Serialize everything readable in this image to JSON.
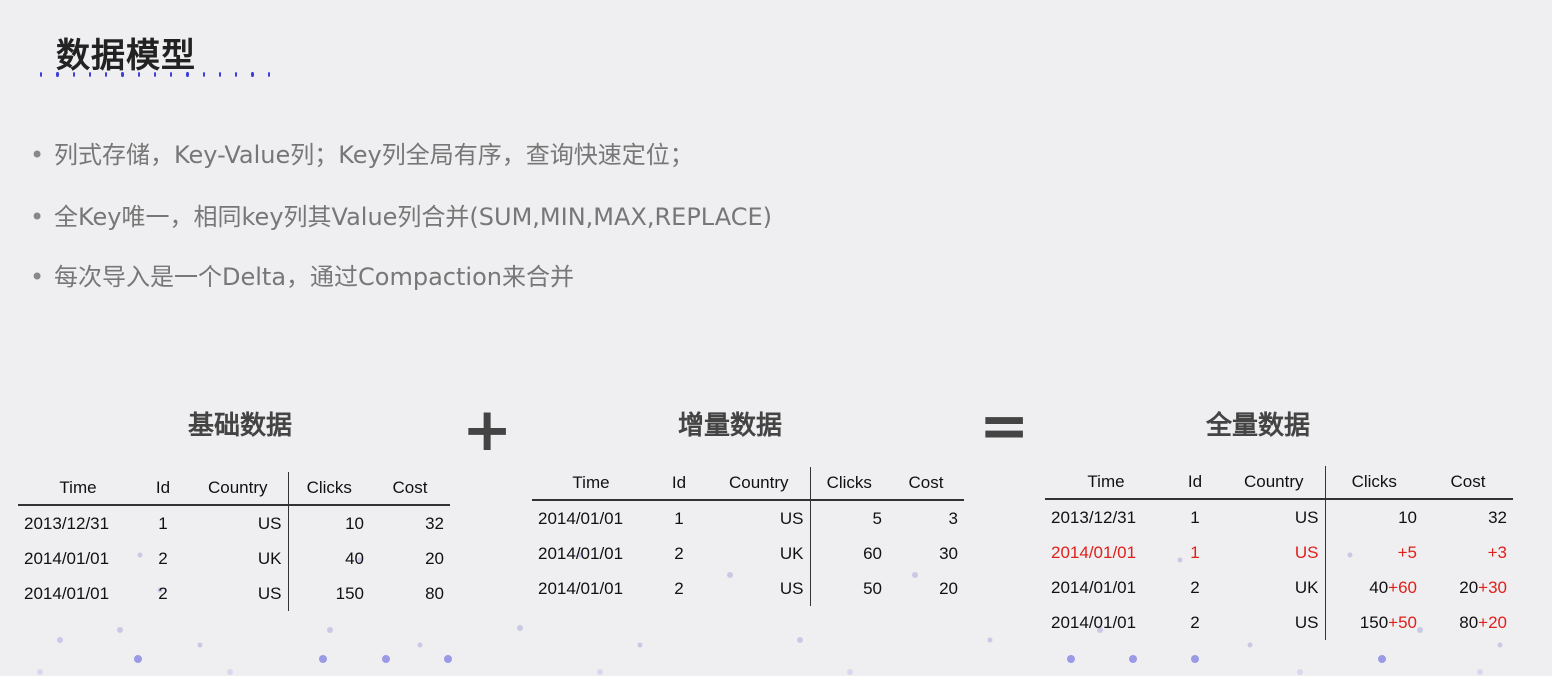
{
  "title": "数据模型",
  "bullets": [
    "列式存储，Key-Value列；Key列全局有序，查询快速定位；",
    "全Key唯一，相同key列其Value列合并(SUM,MIN,MAX,REPLACE)",
    "每次导入是一个Delta，通过Compaction来合并"
  ],
  "bullet_symbol": "•",
  "operators": {
    "plus": "+",
    "equals": "="
  },
  "base": {
    "title": "基础数据",
    "headers": [
      "Time",
      "Id",
      "Country",
      "Clicks",
      "Cost"
    ],
    "rows": [
      [
        "2013/12/31",
        "1",
        "US",
        "10",
        "32"
      ],
      [
        "2014/01/01",
        "2",
        "UK",
        "40",
        "20"
      ],
      [
        "2014/01/01",
        "2",
        "US",
        "150",
        "80"
      ]
    ]
  },
  "delta": {
    "title": "增量数据",
    "headers": [
      "Time",
      "Id",
      "Country",
      "Clicks",
      "Cost"
    ],
    "rows": [
      [
        "2014/01/01",
        "1",
        "US",
        "5",
        "3"
      ],
      [
        "2014/01/01",
        "2",
        "UK",
        "60",
        "30"
      ],
      [
        "2014/01/01",
        "2",
        "US",
        "50",
        "20"
      ]
    ]
  },
  "full": {
    "title": "全量数据",
    "headers": [
      "Time",
      "Id",
      "Country",
      "Clicks",
      "Cost"
    ],
    "rows": [
      {
        "time": "2013/12/31",
        "id": "1",
        "country": "US",
        "clicks_base": "10",
        "clicks_add": "",
        "cost_base": "32",
        "cost_add": ""
      },
      {
        "time": "2014/01/01",
        "id": "1",
        "country": "US",
        "clicks_base": "",
        "clicks_add": "+5",
        "cost_base": "",
        "cost_add": "+3",
        "all_red": true
      },
      {
        "time": "2014/01/01",
        "id": "2",
        "country": "UK",
        "clicks_base": "40",
        "clicks_add": "+60",
        "cost_base": "20",
        "cost_add": "+30"
      },
      {
        "time": "2014/01/01",
        "id": "2",
        "country": "US",
        "clicks_base": "150",
        "clicks_add": "+50",
        "cost_base": "80",
        "cost_add": "+20"
      }
    ]
  },
  "colors": {
    "accent_dots": "#3b3bd9",
    "highlight": "#e0201a"
  }
}
